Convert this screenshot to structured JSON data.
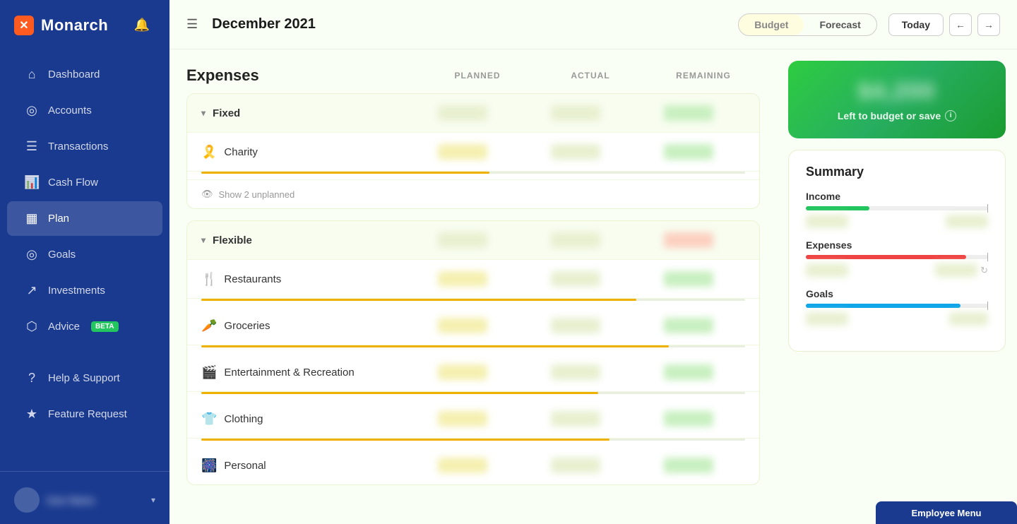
{
  "app": {
    "name": "Monarch"
  },
  "sidebar": {
    "items": [
      {
        "id": "dashboard",
        "label": "Dashboard",
        "icon": "⌂"
      },
      {
        "id": "accounts",
        "label": "Accounts",
        "icon": "◎"
      },
      {
        "id": "transactions",
        "label": "Transactions",
        "icon": "☰"
      },
      {
        "id": "cashflow",
        "label": "Cash Flow",
        "icon": "↑"
      },
      {
        "id": "plan",
        "label": "Plan",
        "icon": "▦",
        "active": true
      },
      {
        "id": "goals",
        "label": "Goals",
        "icon": "◎"
      },
      {
        "id": "investments",
        "label": "Investments",
        "icon": "↗"
      },
      {
        "id": "advice",
        "label": "Advice",
        "icon": "⬡",
        "badge": "BETA"
      }
    ],
    "bottom_items": [
      {
        "id": "help",
        "label": "Help & Support",
        "icon": "?"
      },
      {
        "id": "feature",
        "label": "Feature Request",
        "icon": "★"
      }
    ]
  },
  "topbar": {
    "menu_icon": "☰",
    "title": "December 2021",
    "toggle": {
      "options": [
        "Budget",
        "Forecast"
      ],
      "active": "Budget"
    },
    "today_label": "Today",
    "prev_label": "←",
    "next_label": "→"
  },
  "expenses": {
    "title": "Expenses",
    "columns": {
      "planned": "PLANNED",
      "actual": "ACTUAL",
      "remaining": "REMAINING"
    },
    "sections": [
      {
        "id": "fixed",
        "label": "Fixed",
        "emoji": "",
        "is_header": true
      },
      {
        "id": "charity",
        "label": "Charity",
        "emoji": "🎗️"
      },
      {
        "id": "show-unplanned",
        "label": "Show 2 unplanned"
      }
    ],
    "flexible_sections": [
      {
        "id": "flexible",
        "label": "Flexible",
        "emoji": "",
        "is_header": true
      },
      {
        "id": "restaurants",
        "label": "Restaurants",
        "emoji": "🍴"
      },
      {
        "id": "groceries",
        "label": "Groceries",
        "emoji": "🥕"
      },
      {
        "id": "entertainment",
        "label": "Entertainment & Recreation",
        "emoji": "🎬"
      },
      {
        "id": "clothing",
        "label": "Clothing",
        "emoji": "👕"
      },
      {
        "id": "personal",
        "label": "Personal",
        "emoji": "🎆"
      }
    ]
  },
  "summary": {
    "left_to_budget_label": "Left to budget or save",
    "title": "Summary",
    "income_label": "Income",
    "expenses_label": "Expenses",
    "goals_label": "Goals"
  },
  "employee_menu": {
    "label": "Employee Menu"
  }
}
